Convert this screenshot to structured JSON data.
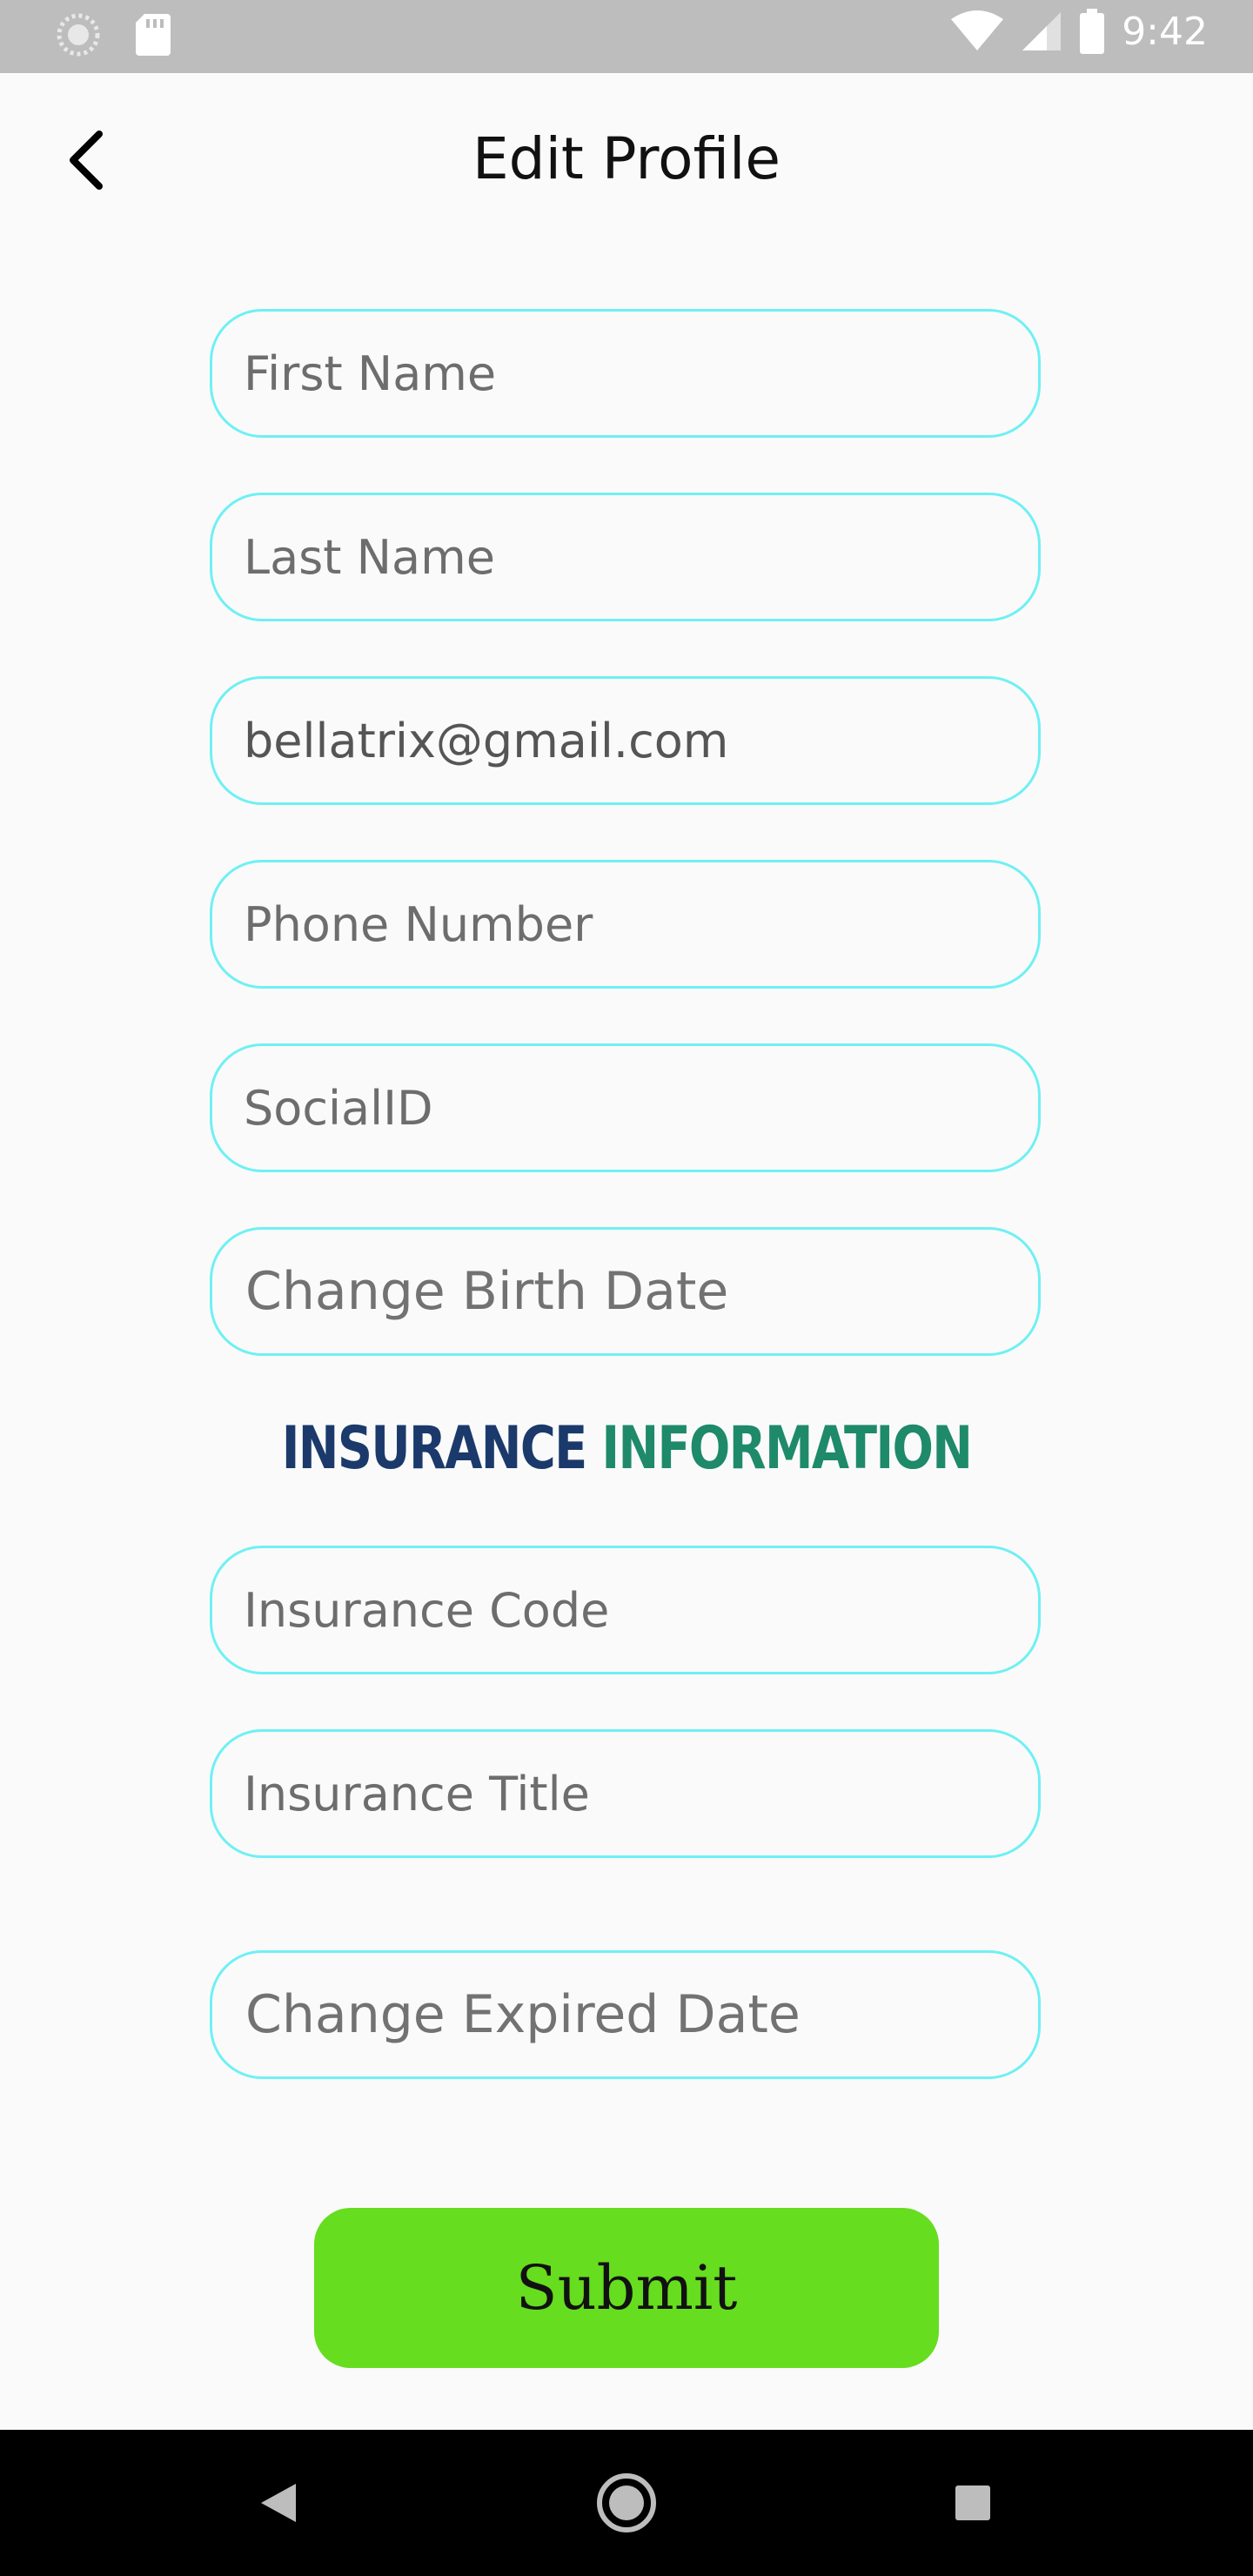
{
  "status_bar": {
    "time": "9:42",
    "icons": [
      "loading-icon",
      "sd-card-icon",
      "wifi-icon",
      "signal-icon",
      "battery-icon"
    ]
  },
  "header": {
    "title": "Edit Profile",
    "back_icon": "back-arrow-icon"
  },
  "form": {
    "first_name": {
      "placeholder": "First Name",
      "value": ""
    },
    "last_name": {
      "placeholder": "Last Name",
      "value": ""
    },
    "email": {
      "placeholder": "",
      "value": "bellatrix@gmail.com"
    },
    "phone": {
      "placeholder": "Phone Number",
      "value": ""
    },
    "social_id": {
      "placeholder": "SocialID",
      "value": ""
    },
    "birth_date_label": "Change Birth Date"
  },
  "insurance": {
    "heading_word1": "INSURANCE",
    "heading_word2": "INFORMATION",
    "code": {
      "placeholder": "Insurance Code",
      "value": ""
    },
    "title": {
      "placeholder": "Insurance Title",
      "value": ""
    },
    "expired_date_label": "Change Expired Date"
  },
  "submit_label": "Submit",
  "nav_bar": {
    "icons": [
      "nav-back-icon",
      "nav-home-icon",
      "nav-recents-icon"
    ]
  },
  "colors": {
    "field_border": "#6ff0f4",
    "submit_bg": "#66dd1e",
    "heading_navy": "#1b3a6b",
    "heading_green": "#1e8a6a"
  }
}
